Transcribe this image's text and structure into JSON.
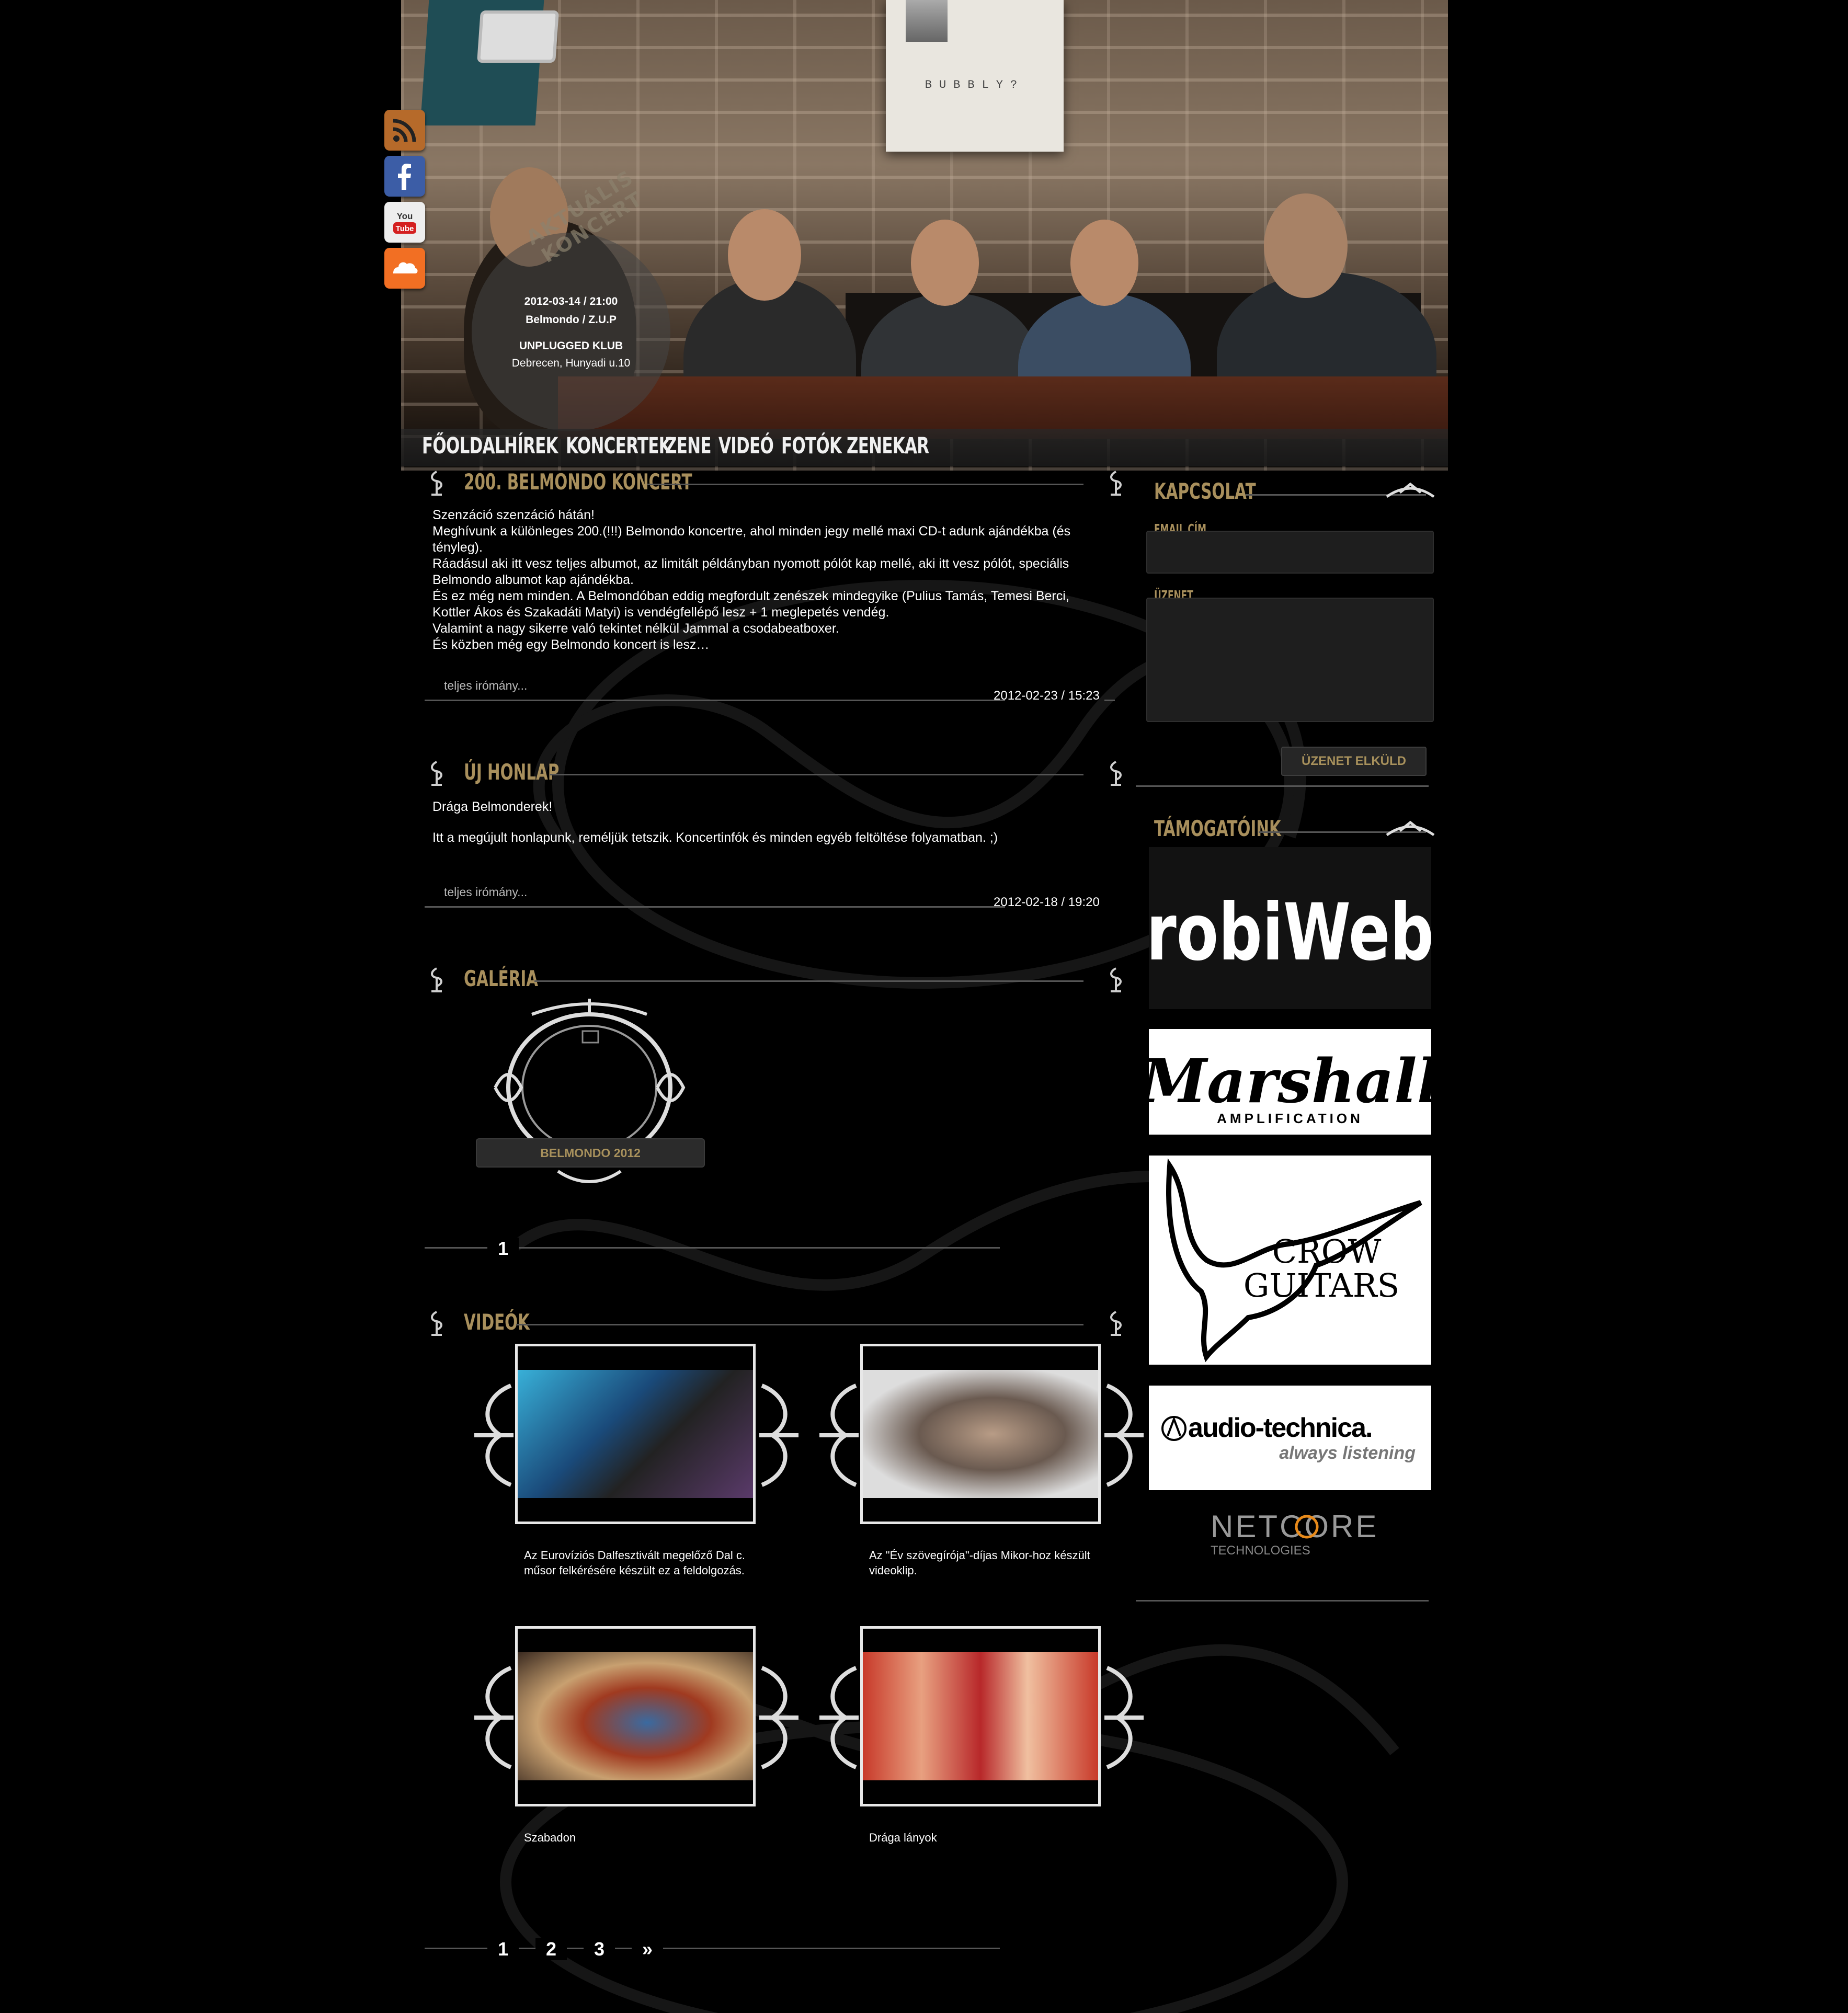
{
  "social": {
    "rss": "rss-icon",
    "facebook": "facebook-icon",
    "youtube": "youtube-icon",
    "soundcloud": "soundcloud-icon",
    "youtube_text_1": "You",
    "youtube_text_2": "Tube"
  },
  "header": {
    "poster_text": "BUBBLY?"
  },
  "concert": {
    "title": "AKTUÁLIS KONCERT",
    "datetime": "2012-03-14 / 21:00",
    "bands": "Belmondo / Z.U.P",
    "venue": "UNPLUGGED KLUB",
    "address": "Debrecen, Hunyadi u.10"
  },
  "nav": [
    "FŐOLDAL",
    "HÍREK",
    "KONCERTEK",
    "ZENE",
    "VIDEÓ",
    "FOTÓK",
    "ZENEKAR"
  ],
  "posts": [
    {
      "title": "200. BELMONDO KONCERT",
      "lines": [
        "Szenzáció szenzáció hátán!",
        "Meghívunk a különleges 200.(!!!) Belmondo koncertre, ahol minden jegy mellé maxi CD-t adunk ajándékba (és",
        "tényleg).",
        "Ráadásul aki itt vesz teljes albumot, az limitált példányban nyomott pólót kap mellé, aki itt vesz pólót, speciális",
        "Belmondo albumot kap ajándékba.",
        "És ez még nem minden. A Belmondóban eddig megfordult zenészek mindegyike (Pulius Tamás, Temesi Berci,",
        "Kottler Ákos és Szakadáti Matyi) is vendégfellépő lesz + 1 meglepetés vendég.",
        "Valamint a nagy sikerre való tekintet nélkül Jammal a csodabeatboxer.",
        "És közben még egy Belmondo koncert is lesz…"
      ],
      "more": "teljes irómány...",
      "date": "2012-02-23 / 15:23"
    },
    {
      "title": "ÚJ HONLAP",
      "lines": [
        "Drága Belmonderek!",
        "",
        "Itt a megújult honlapunk, reméljük tetszik. Koncertinfók és minden egyéb feltöltése folyamatban. ;)"
      ],
      "more": "teljes irómány...",
      "date": "2012-02-18 / 19:20"
    }
  ],
  "gallery": {
    "title": "GALÉRIA",
    "album": "BELMONDO 2012",
    "pages": [
      "1"
    ]
  },
  "videos": {
    "title": "VIDEÓK",
    "items": [
      {
        "caption": "Az Eurovíziós Dalfesztivált megelőző Dal c. műsor felkérésére készült ez a feldolgozás."
      },
      {
        "caption": "Az \"Év szövegírója\"-díjas Mikor-hoz készült videoklip."
      },
      {
        "caption": "Szabadon"
      },
      {
        "caption": "Drága lányok"
      }
    ],
    "pages": [
      "1",
      "2",
      "3",
      "»"
    ]
  },
  "contact": {
    "title": "KAPCSOLAT",
    "email_label": "EMAIL CÍM",
    "message_label": "ÜZENET",
    "send": "ÜZENET ELKÜLD"
  },
  "sponsors": {
    "title": "TÁMOGATÓINK",
    "robiweb": "robiWeb",
    "marshall": "Marshall",
    "marshall_sub": "AMPLIFICATION",
    "crow_1": "CROW",
    "crow_2": "GUITARS",
    "audio": "audio-technica.",
    "audio_sub": "always listening",
    "netcore": "NETCORE",
    "netcore_sub": "TECHNOLOGIES"
  },
  "colors": {
    "accent": "#a88f5c",
    "background": "#000000"
  }
}
